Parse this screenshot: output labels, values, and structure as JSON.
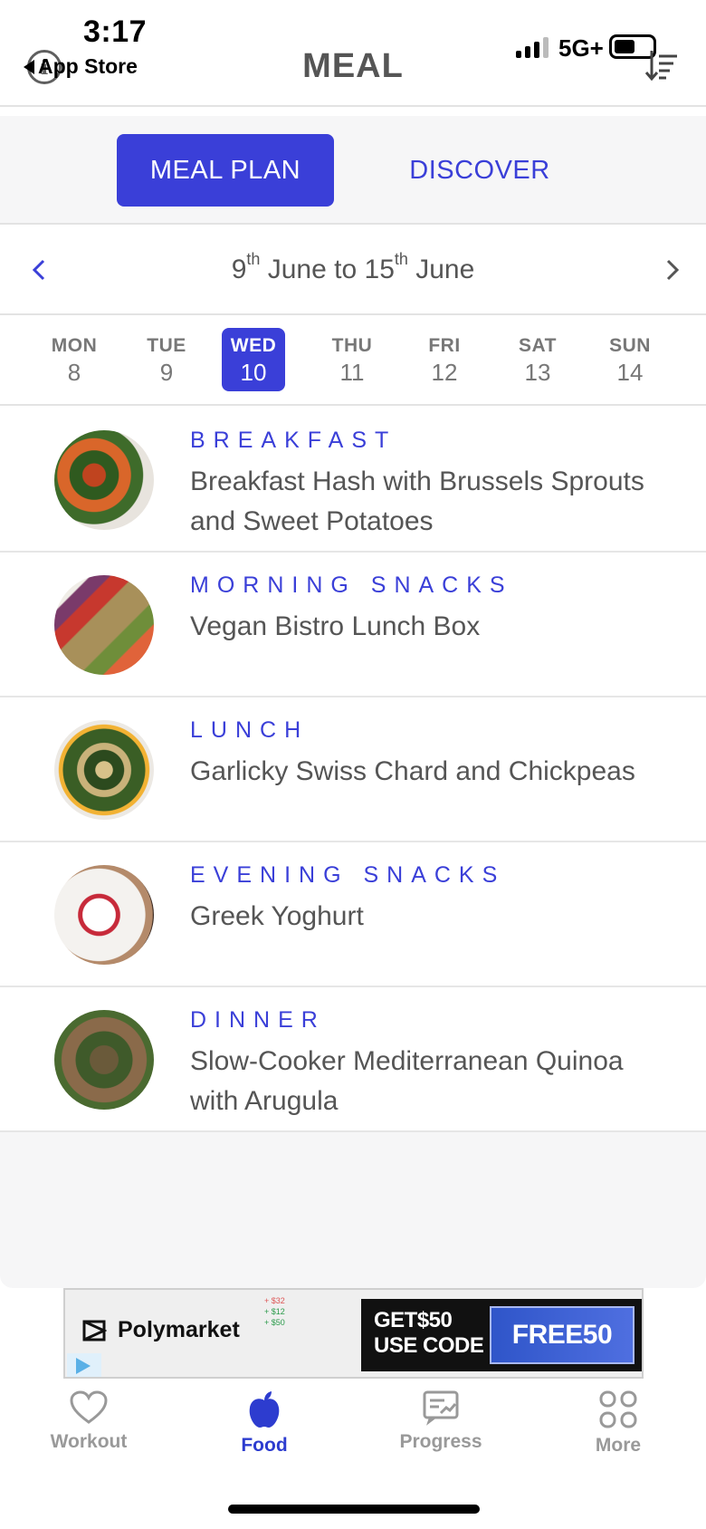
{
  "status_bar": {
    "time": "3:17",
    "back_label": "App Store",
    "network": "5G+"
  },
  "header": {
    "title": "MEAL"
  },
  "segments": [
    {
      "label": "MEAL PLAN",
      "active": true
    },
    {
      "label": "DISCOVER",
      "active": false
    }
  ],
  "week": {
    "start_day": "9",
    "start_suffix": "th",
    "start_month": "June",
    "connector": "to",
    "end_day": "15",
    "end_suffix": "th",
    "end_month": "June"
  },
  "days": [
    {
      "name": "MON",
      "date": "8"
    },
    {
      "name": "TUE",
      "date": "9"
    },
    {
      "name": "WED",
      "date": "10",
      "active": true
    },
    {
      "name": "THU",
      "date": "11"
    },
    {
      "name": "FRI",
      "date": "12"
    },
    {
      "name": "SAT",
      "date": "13"
    },
    {
      "name": "SUN",
      "date": "14"
    }
  ],
  "meals": [
    {
      "type": "BREAKFAST",
      "name": "Breakfast Hash with Brussels Sprouts and Sweet Potatoes"
    },
    {
      "type": "MORNING SNACKS",
      "name": "Vegan Bistro Lunch Box"
    },
    {
      "type": "LUNCH",
      "name": "Garlicky Swiss Chard and Chickpeas"
    },
    {
      "type": "EVENING SNACKS",
      "name": "Greek Yoghurt"
    },
    {
      "type": "DINNER",
      "name": "Slow-Cooker Mediterranean Quinoa with Arugula"
    }
  ],
  "ad": {
    "brand": "Polymarket",
    "line1": "GET$50",
    "line2": "USE CODE",
    "code": "FREE50",
    "amounts": [
      "+ $32",
      "+ $12",
      "+ $50"
    ]
  },
  "tabs": [
    {
      "label": "Workout",
      "icon": "heart-icon"
    },
    {
      "label": "Food",
      "icon": "apple-icon",
      "active": true
    },
    {
      "label": "Progress",
      "icon": "progress-icon"
    },
    {
      "label": "More",
      "icon": "grid-icon"
    }
  ],
  "colors": {
    "accent": "#3a3fd8",
    "text": "#555555",
    "background": "#f6f6f7"
  }
}
